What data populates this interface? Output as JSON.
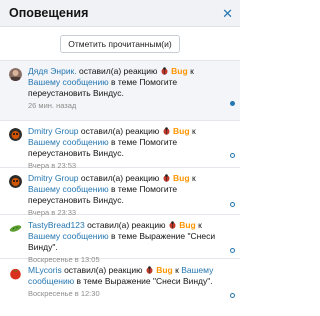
{
  "header": {
    "title": "Оповещения",
    "close_glyph": "✕"
  },
  "mark_read_label": "Отметить прочитанным(и)",
  "reaction_icon": "bug-icon",
  "colors": {
    "link": "#2577b1",
    "reaction": "#ff9500",
    "unread_bg": "#f3f5f8"
  },
  "notifications": [
    {
      "user": "Дядя Энрик.",
      "action": "оставил(а) реакцию",
      "reaction": "Bug",
      "to": "к",
      "target": "Вашему сообщению",
      "suffix": "в теме Помогите переустановить Виндус.",
      "time": "26 мин. назад",
      "unread": true,
      "avatar_icon": "face-avatar-icon"
    },
    {
      "user": "Dmitry Group",
      "action": "оставил(а) реакцию",
      "reaction": "Bug",
      "to": "к",
      "target": "Вашему сообщению",
      "suffix": "в теме Помогите переустановить Виндус.",
      "time": "Вчера в 23:53",
      "unread": false,
      "avatar_icon": "monster-avatar-icon"
    },
    {
      "user": "Dmitry Group",
      "action": "оставил(а) реакцию",
      "reaction": "Bug",
      "to": "к",
      "target": "Вашему сообщению",
      "suffix": "в теме Помогите переустановить Виндус.",
      "time": "Вчера в 23:33",
      "unread": false,
      "avatar_icon": "monster-avatar-icon"
    },
    {
      "user": "TastyBread123",
      "action": "оставил(а) реакцию",
      "reaction": "Bug",
      "to": "к",
      "target": "Вашему сообщению",
      "suffix": "в теме Выражение \"Снеси Винду\".",
      "time": "Воскресенье в 13:05",
      "unread": false,
      "avatar_icon": "cucumber-avatar-icon"
    },
    {
      "user": "MLycoris",
      "action": "оставил(а) реакцию",
      "reaction": "Bug",
      "to": "к",
      "target": "Вашему сообщению",
      "suffix": "в теме Выражение \"Снеси Винду\".",
      "time": "Воскресенье в 12:30",
      "unread": false,
      "avatar_icon": "tomato-avatar-icon"
    }
  ]
}
